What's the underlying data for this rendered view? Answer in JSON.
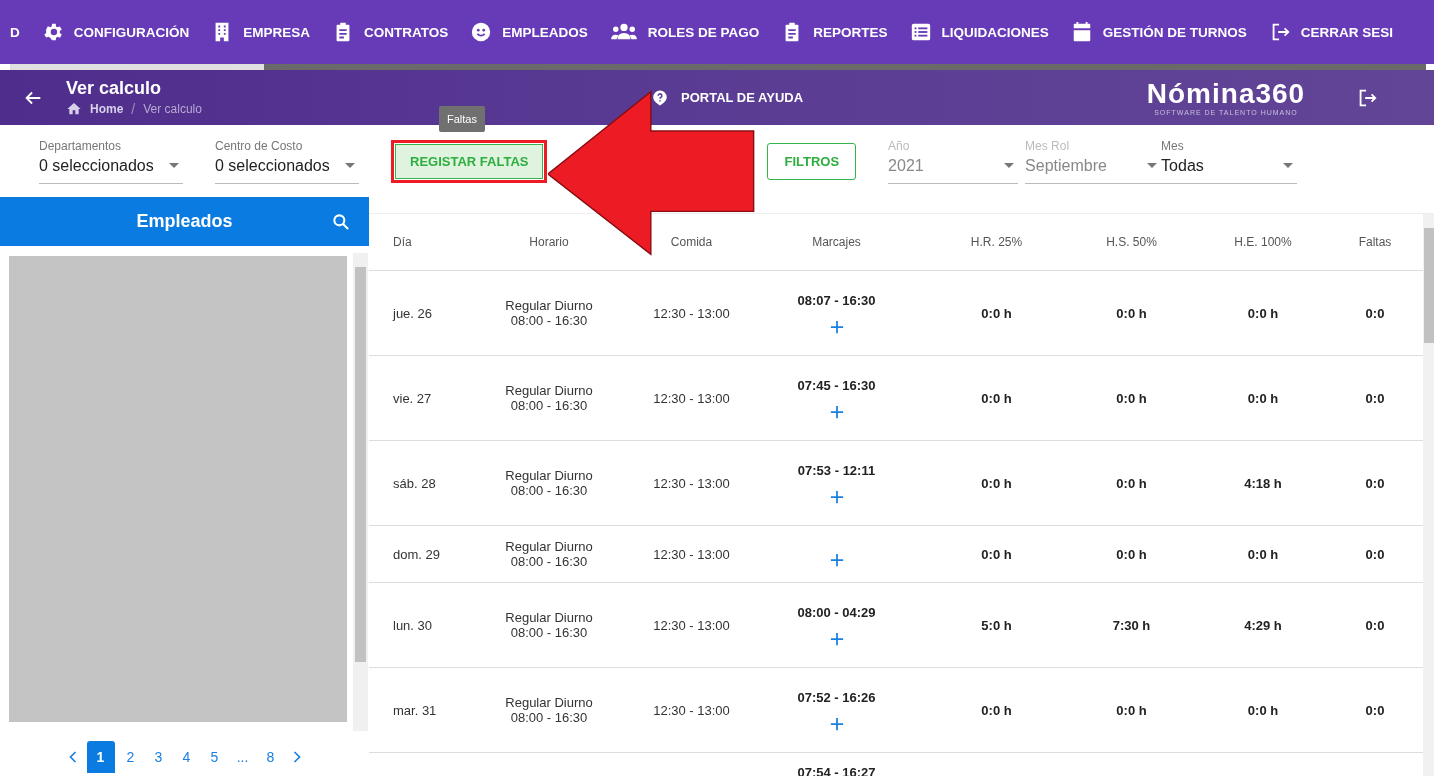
{
  "nav": [
    {
      "label": "D",
      "kind": "plain"
    },
    {
      "label": "CONFIGURACIÓN",
      "kind": "gear"
    },
    {
      "label": "EMPRESA",
      "kind": "building"
    },
    {
      "label": "CONTRATOS",
      "kind": "clipboard"
    },
    {
      "label": "EMPLEADOS",
      "kind": "face"
    },
    {
      "label": "ROLES DE PAGO",
      "kind": "group"
    },
    {
      "label": "REPORTES",
      "kind": "clipboard"
    },
    {
      "label": "LIQUIDACIONES",
      "kind": "list"
    },
    {
      "label": "GESTIÓN DE TURNOS",
      "kind": "calendar"
    },
    {
      "label": "CERRAR SESI",
      "kind": "logout"
    }
  ],
  "header": {
    "title": "Ver calculo",
    "breadcrumb": [
      "Home",
      "Ver calculo"
    ],
    "breadcrumb_separator": "/",
    "help": "PORTAL DE AYUDA",
    "logo": "Nómina360",
    "logo_tagline": "SOFTWARE DE TALENTO HUMANO"
  },
  "filters": [
    {
      "label": "Departamentos",
      "value": "0 seleccionados",
      "disabled": false
    },
    {
      "label": "Centro de Costo",
      "value": "0 seleccionados",
      "disabled": false
    }
  ],
  "tooltip": "Faltas",
  "register_button": "REGISTAR FALTAS",
  "filters_button": "FILTROS",
  "period": [
    {
      "label": "Año",
      "value": "2021",
      "disabled": true
    },
    {
      "label": "Mes Rol",
      "value": "Septiembre",
      "disabled": true
    },
    {
      "label": "Mes",
      "value": "Todas",
      "disabled": false
    }
  ],
  "employees": {
    "title": "Empleados",
    "pages": [
      {
        "label": "1",
        "selected": true
      },
      {
        "label": "2",
        "selected": false
      },
      {
        "label": "3",
        "selected": false
      },
      {
        "label": "4",
        "selected": false
      },
      {
        "label": "5",
        "selected": false
      },
      {
        "label": "...",
        "selected": false
      },
      {
        "label": "8",
        "selected": false
      }
    ]
  },
  "table": {
    "columns": [
      "Día",
      "Horario",
      "Comida",
      "Marcajes",
      "H.R. 25%",
      "H.S. 50%",
      "H.E. 100%",
      "Faltas"
    ],
    "rows": [
      {
        "day": "jue. 26",
        "shift": "Regular Diurno",
        "shift_time": "08:00 - 16:30",
        "meal": "12:30 - 13:00",
        "mark": "08:07 - 16:30",
        "hr": "0:0 h",
        "hs": "0:0 h",
        "he": "0:0 h",
        "absences": "0:0"
      },
      {
        "day": "vie. 27",
        "shift": "Regular Diurno",
        "shift_time": "08:00 - 16:30",
        "meal": "12:30 - 13:00",
        "mark": "07:45 - 16:30",
        "hr": "0:0 h",
        "hs": "0:0 h",
        "he": "0:0 h",
        "absences": "0:0"
      },
      {
        "day": "sáb. 28",
        "shift": "Regular Diurno",
        "shift_time": "08:00 - 16:30",
        "meal": "12:30 - 13:00",
        "mark": "07:53 - 12:11",
        "hr": "0:0 h",
        "hs": "0:0 h",
        "he": "4:18 h",
        "absences": "0:0"
      },
      {
        "day": "dom. 29",
        "shift": "Regular Diurno",
        "shift_time": "08:00 - 16:30",
        "meal": "12:30 - 13:00",
        "hr": "0:0 h",
        "hs": "0:0 h",
        "he": "0:0 h",
        "absences": "0:0"
      },
      {
        "day": "lun. 30",
        "shift": "Regular Diurno",
        "shift_time": "08:00 - 16:30",
        "meal": "12:30 - 13:00",
        "mark": "08:00 - 04:29",
        "hr": "5:0 h",
        "hs": "7:30 h",
        "he": "4:29 h",
        "absences": "0:0"
      },
      {
        "day": "mar. 31",
        "shift": "Regular Diurno",
        "shift_time": "08:00 - 16:30",
        "meal": "12:30 - 13:00",
        "mark": "07:52 - 16:26",
        "hr": "0:0 h",
        "hs": "0:0 h",
        "he": "0:0 h",
        "absences": "0:0"
      },
      {
        "mark": "07:54 - 16:27"
      }
    ]
  }
}
